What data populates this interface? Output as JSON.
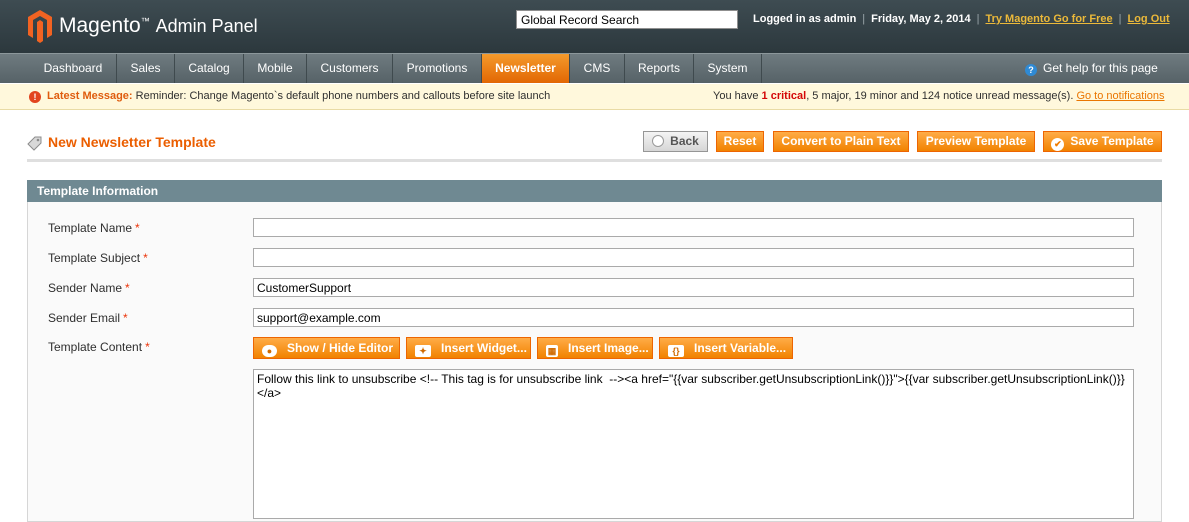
{
  "header": {
    "logo_text": "Magento",
    "logo_tm": "™",
    "logo_sub": "Admin Panel",
    "search_value": "Global Record Search",
    "logged_in": "Logged in as admin",
    "date": "Friday, May 2, 2014",
    "try_link": "Try Magento Go for Free",
    "logout_link": "Log Out",
    "separator": "|"
  },
  "nav": {
    "items": [
      {
        "label": "Dashboard"
      },
      {
        "label": "Sales"
      },
      {
        "label": "Catalog"
      },
      {
        "label": "Mobile"
      },
      {
        "label": "Customers"
      },
      {
        "label": "Promotions"
      },
      {
        "label": "Newsletter"
      },
      {
        "label": "CMS"
      },
      {
        "label": "Reports"
      },
      {
        "label": "System"
      }
    ],
    "active": "Newsletter",
    "help": "Get help for this page"
  },
  "notice": {
    "label": "Latest Message:",
    "text": "Reminder: Change Magento`s default phone numbers and callouts before site launch",
    "pre": "You have",
    "critical": "1 critical",
    "rest": ", 5 major, 19 minor and 124 notice unread message(s).",
    "link": "Go to notifications"
  },
  "page": {
    "title": "New Newsletter Template",
    "buttons": {
      "back": "Back",
      "reset": "Reset",
      "convert": "Convert to Plain Text",
      "preview": "Preview Template",
      "save": "Save Template"
    }
  },
  "section": {
    "title": "Template Information",
    "fields": {
      "name_label": "Template Name",
      "name_value": "",
      "subject_label": "Template Subject",
      "subject_value": "",
      "sender_name_label": "Sender Name",
      "sender_name_value": "CustomerSupport",
      "sender_email_label": "Sender Email",
      "sender_email_value": "support@example.com",
      "content_label": "Template Content",
      "required_mark": "*"
    },
    "editor_buttons": {
      "show_hide": "Show / Hide Editor",
      "widget": "Insert Widget...",
      "image": "Insert Image...",
      "variable": "Insert Variable..."
    },
    "content_value": "Follow this link to unsubscribe <!-- This tag is for unsubscribe link  --><a href=\"{{var subscriber.getUnsubscriptionLink()}}\">{{var subscriber.getUnsubscriptionLink()}}</a>"
  },
  "colors": {
    "header_bg": "#2c383d",
    "nav_active": "#e26703",
    "accent_orange": "#f18200",
    "title_orange": "#eb5e00",
    "section_head": "#6f8992"
  }
}
